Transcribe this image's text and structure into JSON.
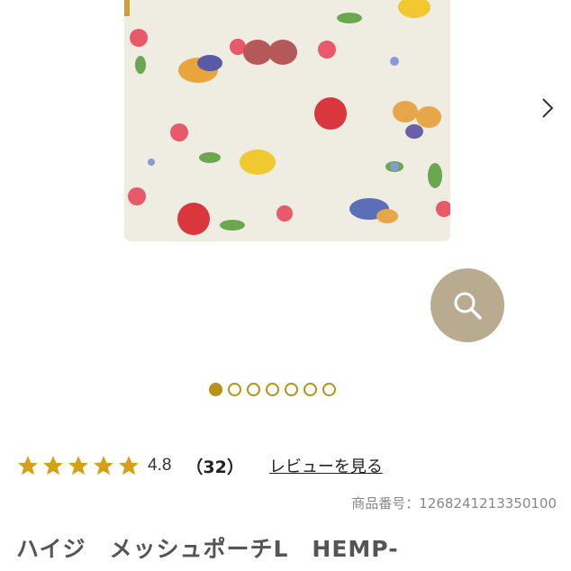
{
  "gallery": {
    "image_alt": "product-photo-floral-pouch",
    "next_icon": "chevron-right-icon",
    "zoom_icon": "search-icon",
    "active_index": 0,
    "total": 7
  },
  "rating": {
    "stars": 5,
    "value": "4.8",
    "count": "（32）",
    "review_link": "レビューを見る"
  },
  "product": {
    "number": "商品番号：1268241213350100",
    "title": "ハイジ　メッシュポーチL　HEMP-"
  },
  "colors": {
    "accent": "#b8901a",
    "zoom_bg": "#b8ab90",
    "star": "#d4a017"
  }
}
